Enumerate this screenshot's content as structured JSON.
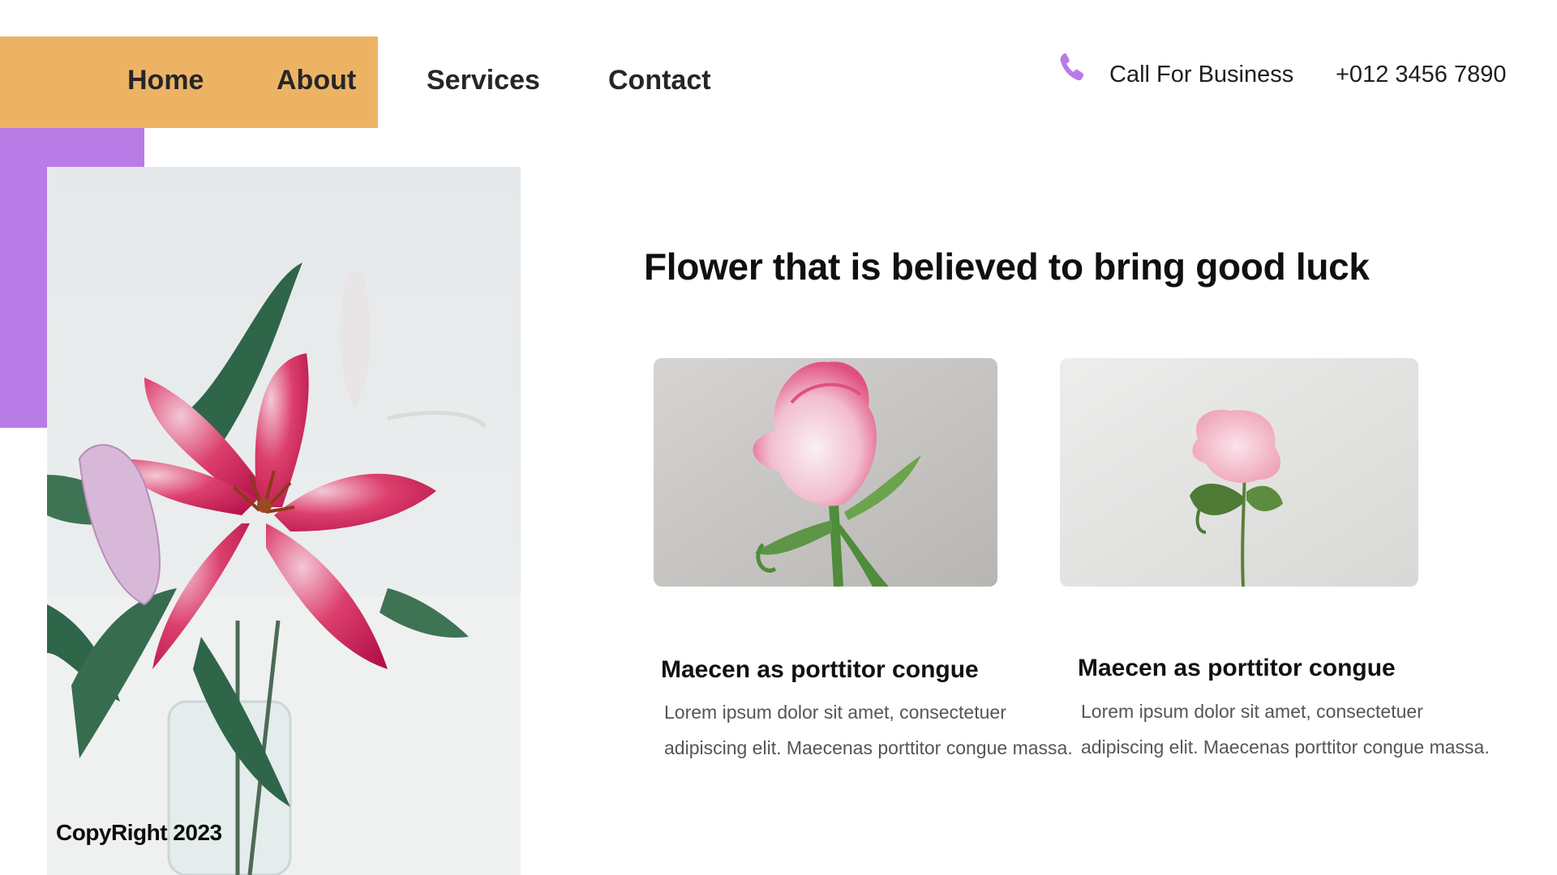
{
  "nav": {
    "home": "Home",
    "about": "About",
    "services": "Services",
    "contact": "Contact"
  },
  "header": {
    "call_label": "Call For Business",
    "phone_number": "+012 3456 7890",
    "phone_icon": "phone-icon"
  },
  "hero": {
    "copyright": "CopyRight 2023"
  },
  "main": {
    "title": "Flower that is believed to bring good luck",
    "cards": [
      {
        "title": "Maecen as porttitor congue",
        "text": "Lorem ipsum dolor sit amet, consectetuer adipiscing elit. Maecenas porttitor congue massa."
      },
      {
        "title": "Maecen as porttitor congue",
        "text": "Lorem ipsum dolor sit amet, consectetuer adipiscing elit. Maecenas porttitor congue massa."
      }
    ]
  },
  "colors": {
    "orange": "#EDB365",
    "purple": "#B97BE6",
    "text_dark": "#1c1c1c",
    "text_muted": "#555555"
  }
}
